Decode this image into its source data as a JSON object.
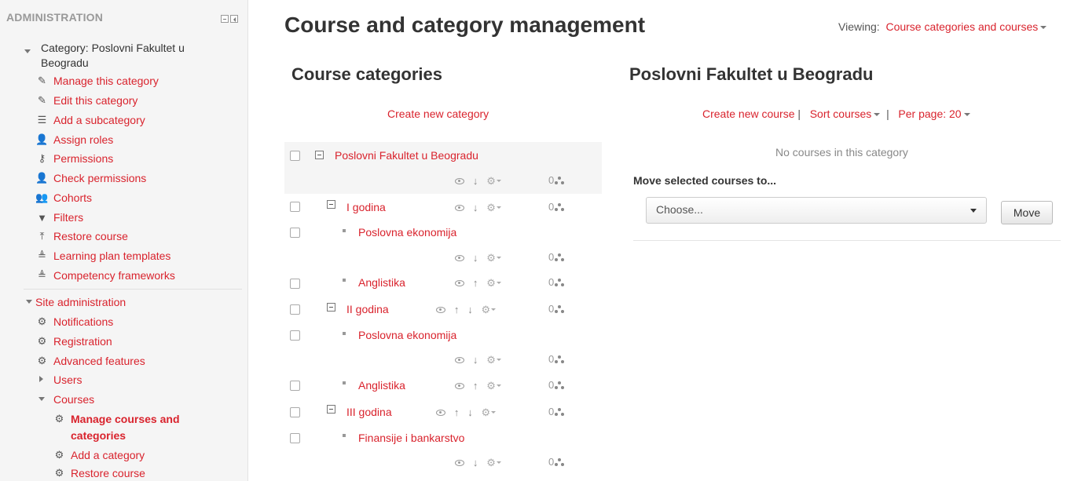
{
  "sidebar": {
    "title": "ADMINISTRATION",
    "category_label": "Category: Poslovni Fakultet u",
    "category_label_2": "Beogradu",
    "category_items": [
      {
        "label": "Manage this category",
        "icon": "pencil-icon"
      },
      {
        "label": "Edit this category",
        "icon": "pencil-icon"
      },
      {
        "label": "Add a subcategory",
        "icon": "subcategory-icon"
      },
      {
        "label": "Assign roles",
        "icon": "user-plus-icon"
      },
      {
        "label": "Permissions",
        "icon": "key-icon"
      },
      {
        "label": "Check permissions",
        "icon": "user-check-icon"
      },
      {
        "label": "Cohorts",
        "icon": "users-icon"
      },
      {
        "label": "Filters",
        "icon": "filter-icon"
      },
      {
        "label": "Restore course",
        "icon": "upload-icon"
      },
      {
        "label": "Learning plan templates",
        "icon": "plan-icon"
      },
      {
        "label": "Competency frameworks",
        "icon": "plan-icon"
      }
    ],
    "site_admin": "Site administration",
    "site_items": [
      {
        "label": "Notifications",
        "icon": "gear-icon"
      },
      {
        "label": "Registration",
        "icon": "gear-icon"
      },
      {
        "label": "Advanced features",
        "icon": "gear-icon"
      }
    ],
    "users": "Users",
    "courses": "Courses",
    "courses_items": [
      {
        "label": "Manage courses and",
        "label2": "categories",
        "icon": "gear-icon"
      },
      {
        "label": "Add a category",
        "icon": "gear-icon"
      },
      {
        "label": "Restore course",
        "icon": "gear-icon"
      }
    ]
  },
  "main": {
    "title": "Course and category management",
    "viewing_label": "Viewing:",
    "viewing_value": "Course categories and courses",
    "categories_heading": "Course categories",
    "create_category": "Create new category",
    "categories": [
      {
        "name": "Poslovni Fakultet u Beogradu",
        "count": "0"
      },
      {
        "name": "I godina",
        "count": "0"
      },
      {
        "name": "Poslovna ekonomija",
        "count": "0"
      },
      {
        "name": "Anglistika",
        "count": "0"
      },
      {
        "name": "II godina",
        "count": "0"
      },
      {
        "name": "Poslovna ekonomija",
        "count": "0"
      },
      {
        "name": "Anglistika",
        "count": "0"
      },
      {
        "name": "III godina",
        "count": "0"
      },
      {
        "name": "Finansije i bankarstvo",
        "count": "0"
      }
    ],
    "course_heading": "Poslovni Fakultet u Beogradu",
    "create_course": "Create new course",
    "sort_courses": "Sort courses",
    "per_page": "Per page: 20",
    "separator": "|",
    "no_courses": "No courses in this category",
    "move_label": "Move selected courses to...",
    "choose": "Choose...",
    "move_button": "Move"
  },
  "colors": {
    "accent": "#d9232d",
    "sidebar_bg": "#f5f5f5",
    "text": "#333333"
  }
}
